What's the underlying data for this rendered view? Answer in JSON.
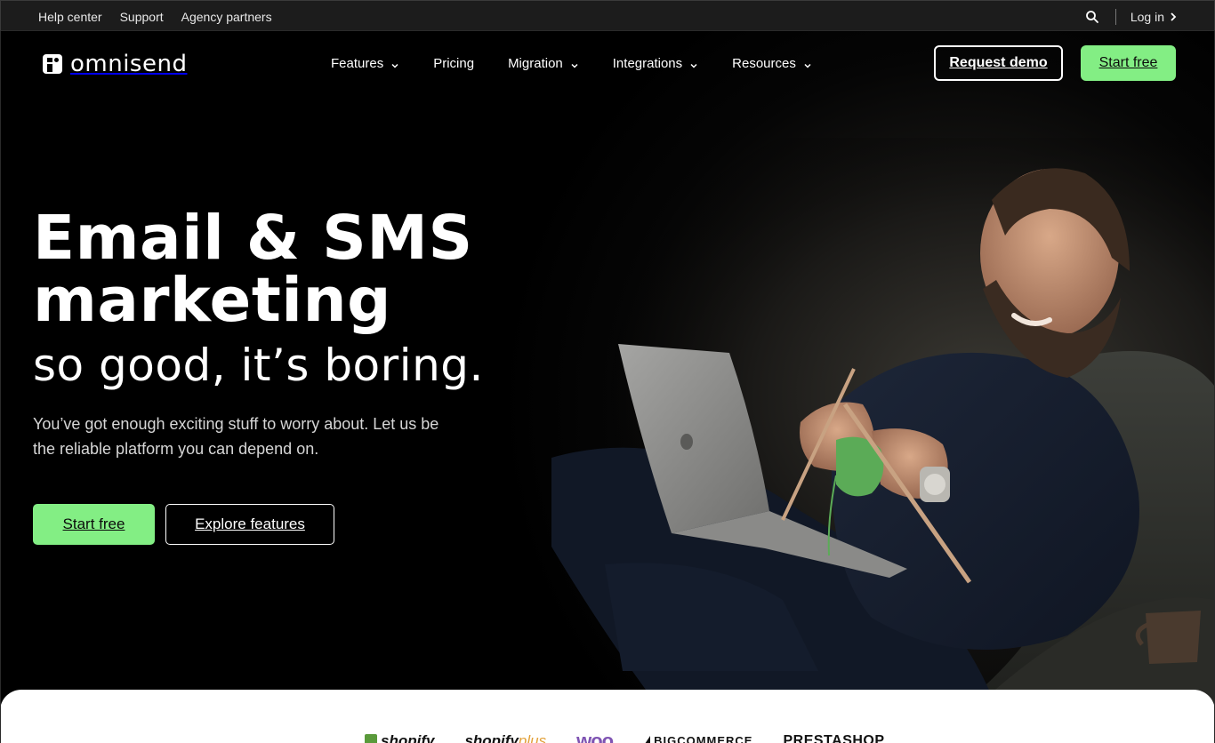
{
  "utility_bar": {
    "links": [
      "Help center",
      "Support",
      "Agency partners"
    ],
    "search_icon": "search-icon",
    "login_label": "Log in"
  },
  "header": {
    "logo_text": "omnisend",
    "nav": [
      {
        "label": "Features",
        "has_dropdown": true
      },
      {
        "label": "Pricing",
        "has_dropdown": false
      },
      {
        "label": "Migration",
        "has_dropdown": true
      },
      {
        "label": "Integrations",
        "has_dropdown": true
      },
      {
        "label": "Resources",
        "has_dropdown": true
      }
    ],
    "request_demo_label": "Request demo",
    "start_free_label": "Start free"
  },
  "hero": {
    "headline_line1": "Email & SMS",
    "headline_line2": "marketing",
    "subheadline": "so good, it’s boring.",
    "description": "You’ve got enough exciting stuff to worry about. Let us be the reliable platform you can depend on.",
    "primary_cta": "Start free",
    "secondary_cta": "Explore features"
  },
  "partners": {
    "shopify": "shopify",
    "shopify_plus_main": "shopify",
    "shopify_plus_suffix": "plus",
    "woo": "woo",
    "bigcommerce": "BIGCOMMERCE",
    "prestashop": "PRESTASHOP"
  },
  "colors": {
    "accent_green": "#83ee84",
    "background": "#000000",
    "utility_bar": "#1c1c1c",
    "woo_purple": "#7f54b3"
  }
}
